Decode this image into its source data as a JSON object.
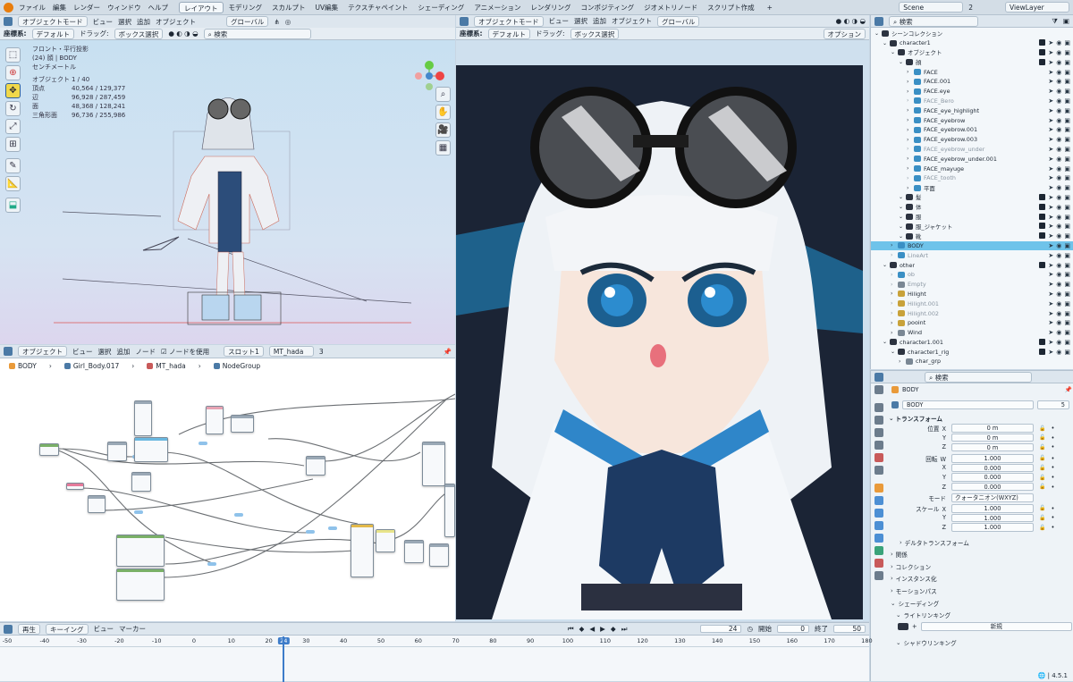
{
  "colors": {
    "accent": "#3d7cc9",
    "select": "#6fc3ea",
    "viewport": "#c0dcef",
    "node_bg": "#ffffff",
    "outliner_bg": "#f3f7fa"
  },
  "menu": {
    "items": [
      "ファイル",
      "編集",
      "レンダー",
      "ウィンドウ",
      "ヘルプ"
    ],
    "workspaces": [
      "レイアウト",
      "モデリング",
      "スカルプト",
      "UV編集",
      "テクスチャペイント",
      "シェーディング",
      "アニメーション",
      "レンダリング",
      "コンポジティング",
      "ジオメトリノード",
      "スクリプト作成"
    ],
    "add": "+",
    "scene": "Scene",
    "scene_num": "2",
    "view_layer": "ViewLayer"
  },
  "vp3d": {
    "mode": "オブジェクトモード",
    "view": "ビュー",
    "select": "選択",
    "add": "追加",
    "object": "オブジェクト",
    "orient": "グローバル",
    "coord_label": "座標系:",
    "coord_value": "デフォルト",
    "drag_label": "ドラッグ:",
    "drag_value": "ボックス選択",
    "search": "検索",
    "overlay_title": "フロント・平行投影",
    "overlay_obj": "(24) 顔 | BODY",
    "overlay_units": "センチメートル",
    "stats": [
      [
        "オブジェクト",
        "1 / 40"
      ],
      [
        "頂点",
        "40,564 / 129,377"
      ],
      [
        "辺",
        "96,928 / 287,459"
      ],
      [
        "面",
        "48,368 / 128,241"
      ],
      [
        "三角形面",
        "96,736 / 255,986"
      ]
    ]
  },
  "nodes": {
    "mode": "オブジェクト",
    "view": "ビュー",
    "select": "選択",
    "add": "追加",
    "node": "ノード",
    "use_nodes": "ノードを使用",
    "slot": "スロット1",
    "material": "MT_hada",
    "users": "3",
    "crumbs": [
      "BODY",
      "Girl_Body.017",
      "MT_hada",
      "NodeGroup"
    ]
  },
  "vp2": {
    "mode": "オブジェクトモード",
    "view": "ビュー",
    "select": "選択",
    "add": "追加",
    "object": "オブジェクト",
    "orient": "グローバル",
    "coord_label": "座標系:",
    "coord_value": "デフォルト",
    "drag_label": "ドラッグ:",
    "drag_value": "ボックス選択",
    "options": "オプション"
  },
  "timeline": {
    "playback": "再生",
    "keying": "キーイング",
    "view": "ビュー",
    "marker": "マーカー",
    "frame": "24",
    "start_label": "開始",
    "start": "0",
    "end_label": "終了",
    "end": "50",
    "ticks": [
      "-50",
      "-40",
      "-30",
      "-20",
      "-10",
      "0",
      "10",
      "20",
      "24",
      "30",
      "40",
      "50",
      "60",
      "70",
      "80",
      "90",
      "100",
      "110",
      "120",
      "130",
      "140",
      "150",
      "160",
      "170",
      "180"
    ],
    "current": "24"
  },
  "outliner": {
    "search": "検索",
    "rows": [
      {
        "l": 0,
        "t": "シーンコレクション",
        "k": "coll",
        "v": false
      },
      {
        "l": 1,
        "t": "character1",
        "k": "coll",
        "v": true
      },
      {
        "l": 2,
        "t": "オブジェクト",
        "k": "coll",
        "v": true
      },
      {
        "l": 3,
        "t": "顔",
        "k": "coll",
        "v": true
      },
      {
        "l": 4,
        "t": "FACE",
        "k": "mesh",
        "v": true
      },
      {
        "l": 4,
        "t": "FACE.001",
        "k": "mesh",
        "v": true
      },
      {
        "l": 4,
        "t": "FACE.eye",
        "k": "mesh",
        "v": true
      },
      {
        "l": 4,
        "t": "FACE_Bero",
        "k": "mesh",
        "v": true,
        "dim": true
      },
      {
        "l": 4,
        "t": "FACE_eye_highlight",
        "k": "mesh",
        "v": true
      },
      {
        "l": 4,
        "t": "FACE_eyebrow",
        "k": "mesh",
        "v": true
      },
      {
        "l": 4,
        "t": "FACE_eyebrow.001",
        "k": "mesh",
        "v": true
      },
      {
        "l": 4,
        "t": "FACE_eyebrow.003",
        "k": "mesh",
        "v": true
      },
      {
        "l": 4,
        "t": "FACE_eyebrow_under",
        "k": "mesh",
        "v": true,
        "dim": true
      },
      {
        "l": 4,
        "t": "FACE_eyebrow_under.001",
        "k": "mesh",
        "v": true
      },
      {
        "l": 4,
        "t": "FACE_mayuge",
        "k": "mesh",
        "v": true
      },
      {
        "l": 4,
        "t": "FACE_tooth",
        "k": "mesh",
        "v": true,
        "dim": true
      },
      {
        "l": 4,
        "t": "平面",
        "k": "mesh",
        "v": true
      },
      {
        "l": 3,
        "t": "髪",
        "k": "coll",
        "v": true
      },
      {
        "l": 3,
        "t": "体",
        "k": "coll",
        "v": true
      },
      {
        "l": 3,
        "t": "服",
        "k": "coll",
        "v": true
      },
      {
        "l": 3,
        "t": "服_ジャケット",
        "k": "coll",
        "v": true
      },
      {
        "l": 3,
        "t": "靴",
        "k": "coll",
        "v": true
      },
      {
        "l": 2,
        "t": "BODY",
        "k": "mesh",
        "v": true,
        "sel": true
      },
      {
        "l": 2,
        "t": "LineArt",
        "k": "mesh",
        "v": true,
        "dim": true
      },
      {
        "l": 1,
        "t": "other",
        "k": "coll",
        "v": true
      },
      {
        "l": 2,
        "t": "ob",
        "k": "mesh",
        "v": true,
        "dim": true
      },
      {
        "l": 2,
        "t": "Empty",
        "k": "empty",
        "v": true,
        "dim": true
      },
      {
        "l": 2,
        "t": "Hilight",
        "k": "light",
        "v": true
      },
      {
        "l": 2,
        "t": "Hilight.001",
        "k": "light",
        "v": true,
        "dim": true
      },
      {
        "l": 2,
        "t": "Hilight.002",
        "k": "light",
        "v": true,
        "dim": true
      },
      {
        "l": 2,
        "t": "pooint",
        "k": "light",
        "v": true
      },
      {
        "l": 2,
        "t": "Wind",
        "k": "empty",
        "v": true
      },
      {
        "l": 1,
        "t": "character1.001",
        "k": "coll",
        "v": true
      },
      {
        "l": 2,
        "t": "character1_rig",
        "k": "coll",
        "v": true
      },
      {
        "l": 3,
        "t": "char_grp",
        "k": "empty",
        "v": false
      }
    ]
  },
  "props": {
    "search": "検索",
    "object": "BODY",
    "name": "BODY",
    "users": "5",
    "transform": "トランスフォーム",
    "location": {
      "label": "位置",
      "x": "0 m",
      "y": "0 m",
      "z": "0 m"
    },
    "rotation": {
      "label": "回転",
      "w": "1.000",
      "x": "0.000",
      "y": "0.000",
      "z": "0.000"
    },
    "mode_label": "モード",
    "mode": "クォータニオン(WXYZ)",
    "scale": {
      "label": "スケール",
      "x": "1.000",
      "y": "1.000",
      "z": "1.000"
    },
    "axes": [
      "X",
      "Y",
      "Z",
      "W"
    ],
    "panels": [
      "デルタトランスフォーム",
      "関係",
      "コレクション",
      "インスタンス化",
      "モーションパス",
      "シェーディング"
    ],
    "light_linking": "ライトリンキング",
    "new": "新規",
    "shadow_linking": "シャドウリンキング",
    "version": "4.5.1"
  }
}
